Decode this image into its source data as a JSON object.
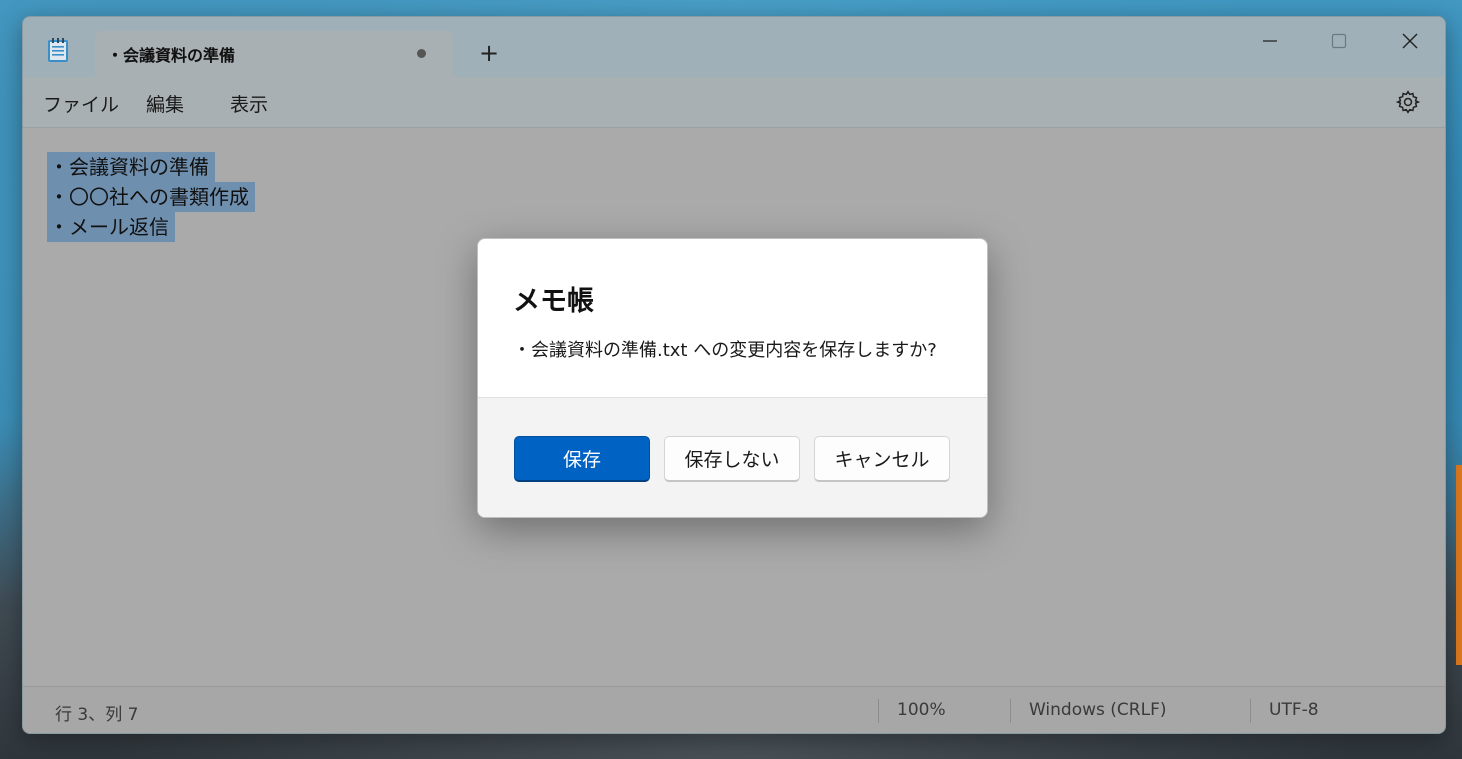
{
  "tab": {
    "title": "・会議資料の準備"
  },
  "menu": {
    "file": "ファイル",
    "edit": "編集",
    "view": "表示"
  },
  "editor": {
    "lines": [
      "・会議資料の準備",
      "・〇〇社への書類作成",
      "・メール返信"
    ]
  },
  "status": {
    "position": "行 3、列 7",
    "zoom": "100%",
    "line_ending": "Windows (CRLF)",
    "encoding": "UTF-8"
  },
  "dialog": {
    "title": "メモ帳",
    "message": "・会議資料の準備.txt への変更内容を保存しますか?",
    "save_label": "保存",
    "dont_save_label": "保存しない",
    "cancel_label": "キャンセル"
  },
  "colors": {
    "accent": "#0063c4",
    "selection": "#6f8fae",
    "unsaved_dot": "#555555"
  },
  "icons": {
    "app": "notepad-icon",
    "new_tab": "plus-icon",
    "settings": "gear-icon",
    "minimize": "minimize-icon",
    "maximize": "maximize-icon",
    "close": "close-icon"
  }
}
